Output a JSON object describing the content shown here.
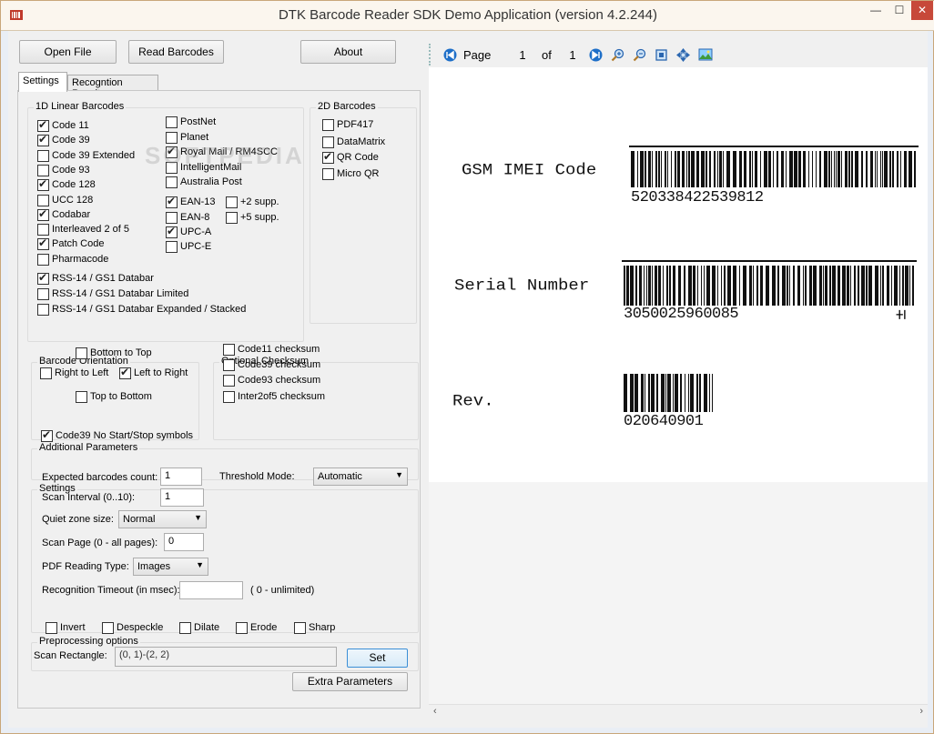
{
  "window": {
    "title": "DTK Barcode Reader SDK Demo Application (version 4.2.244)",
    "min": "—",
    "max": "☐",
    "close": "✕"
  },
  "toolbar": {
    "open_file": "Open File",
    "read_barcodes": "Read Barcodes",
    "about": "About"
  },
  "tabs": [
    "Settings",
    "Recogntion Results"
  ],
  "linear": {
    "title": "1D Linear Barcodes",
    "col1": [
      {
        "label": "Code 11",
        "checked": true
      },
      {
        "label": "Code 39",
        "checked": true
      },
      {
        "label": "Code 39 Extended",
        "checked": false
      },
      {
        "label": "Code 93",
        "checked": false
      },
      {
        "label": "Code 128",
        "checked": true
      },
      {
        "label": "UCC 128",
        "checked": false
      },
      {
        "label": "Codabar",
        "checked": true
      },
      {
        "label": "Interleaved 2 of 5",
        "checked": false
      },
      {
        "label": "Patch Code",
        "checked": true
      },
      {
        "label": "Pharmacode",
        "checked": false
      }
    ],
    "rss": [
      {
        "label": "RSS-14 / GS1 Databar",
        "checked": true
      },
      {
        "label": "RSS-14 / GS1 Databar Limited",
        "checked": false
      },
      {
        "label": "RSS-14 / GS1 Databar Expanded / Stacked",
        "checked": false
      }
    ],
    "col2": [
      {
        "label": "PostNet",
        "checked": false
      },
      {
        "label": "Planet",
        "checked": false
      },
      {
        "label": "Royal Mail / RM4SCC",
        "checked": true
      },
      {
        "label": "IntelligentMail",
        "checked": false
      },
      {
        "label": "Australia Post",
        "checked": false
      }
    ],
    "col2b": [
      {
        "label": "EAN-13",
        "checked": true
      },
      {
        "label": "EAN-8",
        "checked": false
      },
      {
        "label": "UPC-A",
        "checked": true
      },
      {
        "label": "UPC-E",
        "checked": false
      }
    ],
    "supp": [
      {
        "label": "+2 supp.",
        "checked": false
      },
      {
        "label": "+5 supp.",
        "checked": false
      }
    ]
  },
  "twod": {
    "title": "2D Barcodes",
    "items": [
      {
        "label": "PDF417",
        "checked": false
      },
      {
        "label": "DataMatrix",
        "checked": false
      },
      {
        "label": "QR Code",
        "checked": true
      },
      {
        "label": "Micro QR",
        "checked": false
      }
    ]
  },
  "orientation": {
    "title": "Barcode Orientation",
    "bottom_to_top": {
      "label": "Bottom to Top",
      "checked": false
    },
    "right_to_left": {
      "label": "Right to Left",
      "checked": false
    },
    "left_to_right": {
      "label": "Left to Right",
      "checked": true
    },
    "top_to_bottom": {
      "label": "Top to Bottom",
      "checked": false
    }
  },
  "checksum": {
    "title": "Optional Checksum",
    "items": [
      {
        "label": "Code11 checksum",
        "checked": false
      },
      {
        "label": "Code39 checksum",
        "checked": false
      },
      {
        "label": "Code93 checksum",
        "checked": false
      },
      {
        "label": "Inter2of5 checksum",
        "checked": false
      }
    ]
  },
  "additional": {
    "title": "Additional Parameters",
    "code39_no_start_stop": {
      "label": "Code39 No Start/Stop symbols",
      "checked": true
    }
  },
  "settings": {
    "title": "Settings",
    "expected_count_label": "Expected barcodes count:",
    "expected_count": "1",
    "threshold_label": "Threshold Mode:",
    "threshold": "Automatic",
    "scan_interval_label": "Scan Interval (0..10):",
    "scan_interval": "1",
    "quiet_zone_label": "Quiet zone size:",
    "quiet_zone": "Normal",
    "scan_page_label": "Scan Page (0 - all pages):",
    "scan_page": "0",
    "pdf_mode_label": "PDF Reading Type:",
    "pdf_mode": "Images",
    "timeout_label": "Recognition Timeout (in msec):",
    "timeout": "",
    "timeout_hint": "( 0 - unlimited)"
  },
  "preprocessing": {
    "title": "Preprocessing options",
    "items": [
      {
        "label": "Invert",
        "checked": false
      },
      {
        "label": "Despeckle",
        "checked": false
      },
      {
        "label": "Dilate",
        "checked": false
      },
      {
        "label": "Erode",
        "checked": false
      },
      {
        "label": "Sharp",
        "checked": false
      }
    ]
  },
  "scan_rect": {
    "label": "Scan Rectangle:",
    "value": "(0, 1)-(2, 2)",
    "set": "Set",
    "extra": "Extra Parameters"
  },
  "viewer": {
    "page_label": "Page",
    "page": "1",
    "of_label": "of",
    "total": "1",
    "watermark": "SOFTPEDIA",
    "document": {
      "imei_label": "GSM IMEI Code",
      "imei_digits": "520338422539812",
      "serial_label": "Serial Number",
      "serial_digits": "3050025960085",
      "rev_label": "Rev.",
      "rev_digits": "020640901"
    }
  },
  "colors": {
    "accent": "#3c8fd6",
    "close_button": "#c7493a",
    "window_border": "#c9a77a"
  }
}
